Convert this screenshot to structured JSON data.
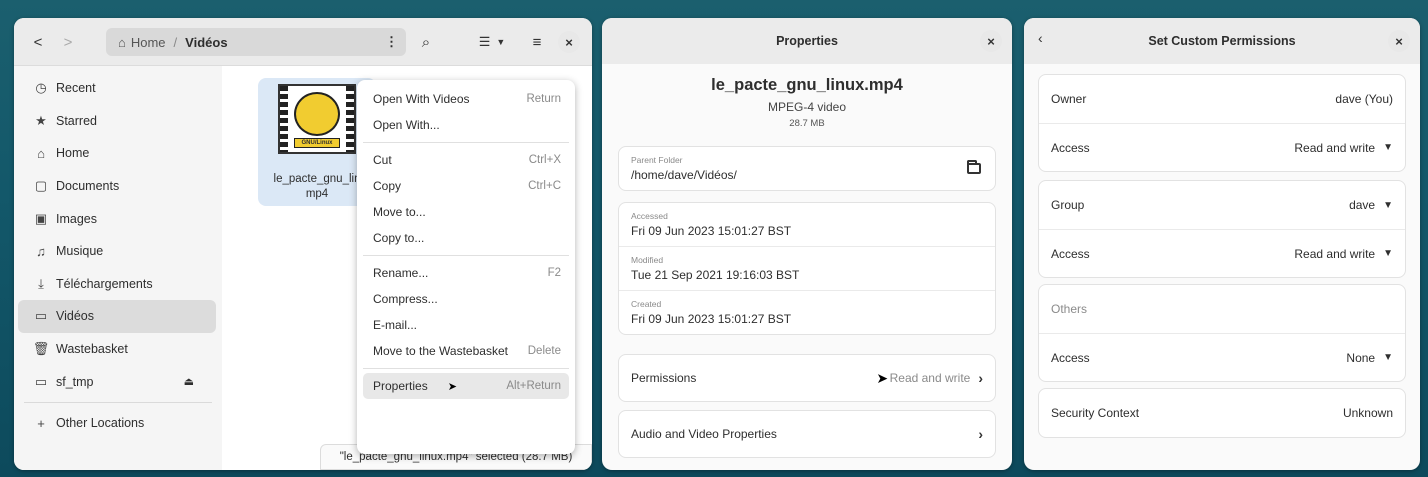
{
  "files": {
    "back_glyph": "<",
    "forward_glyph": ">",
    "path": {
      "home": "Home",
      "separator": "/",
      "current": "Vidéos"
    },
    "sidebar": [
      {
        "icon": "clock-icon",
        "glyph": "◷",
        "label": "Recent"
      },
      {
        "icon": "star-icon",
        "glyph": "★",
        "label": "Starred"
      },
      {
        "icon": "home-icon",
        "glyph": "⌂",
        "label": "Home"
      },
      {
        "icon": "document-icon",
        "glyph": "▢",
        "label": "Documents"
      },
      {
        "icon": "image-icon",
        "glyph": "▣",
        "label": "Images"
      },
      {
        "icon": "music-icon",
        "glyph": "♫",
        "label": "Musique"
      },
      {
        "icon": "download-icon",
        "glyph": "⤓",
        "label": "Téléchargements"
      },
      {
        "icon": "video-icon",
        "glyph": "▭",
        "label": "Vidéos"
      },
      {
        "icon": "trash-icon",
        "glyph": "🗑",
        "label": "Wastebasket"
      },
      {
        "icon": "drive-icon",
        "glyph": "▭",
        "label": "sf_tmp"
      }
    ],
    "other_locations": "Other Locations",
    "file": {
      "name_line1": "le_pacte_gnu_lin",
      "name_line2": "mp4",
      "thumb_label": "GNU/Linux"
    },
    "status": "\"le_pacte_gnu_linux.mp4\" selected  (28.7 MB)"
  },
  "context_menu": {
    "group1": [
      {
        "label": "Open With Videos",
        "accel": "Return"
      },
      {
        "label": "Open With...",
        "accel": ""
      }
    ],
    "group2": [
      {
        "label": "Cut",
        "accel": "Ctrl+X"
      },
      {
        "label": "Copy",
        "accel": "Ctrl+C"
      },
      {
        "label": "Move to...",
        "accel": ""
      },
      {
        "label": "Copy to...",
        "accel": ""
      }
    ],
    "group3": [
      {
        "label": "Rename...",
        "accel": "F2"
      },
      {
        "label": "Compress...",
        "accel": ""
      },
      {
        "label": "E-mail...",
        "accel": ""
      },
      {
        "label": "Move to the Wastebasket",
        "accel": "Delete"
      }
    ],
    "group4": [
      {
        "label": "Properties",
        "accel": "Alt+Return"
      }
    ]
  },
  "properties": {
    "title": "Properties",
    "file_name": "le_pacte_gnu_linux.mp4",
    "file_type": "MPEG-4 video",
    "file_size": "28.7 MB",
    "parent_folder_label": "Parent Folder",
    "parent_folder_value": "/home/dave/Vidéos/",
    "accessed_label": "Accessed",
    "accessed_value": "Fri 09 Jun 2023 15:01:27 BST",
    "modified_label": "Modified",
    "modified_value": "Tue 21 Sep 2021 19:16:03 BST",
    "created_label": "Created",
    "created_value": "Fri 09 Jun 2023 15:01:27 BST",
    "permissions_label": "Permissions",
    "permissions_value": "Read and write",
    "av_label": "Audio and Video Properties"
  },
  "permissions": {
    "title": "Set Custom Permissions",
    "owner_label": "Owner",
    "owner_value": "dave (You)",
    "owner_access_label": "Access",
    "owner_access_value": "Read and write",
    "group_label": "Group",
    "group_value": "dave",
    "group_access_label": "Access",
    "group_access_value": "Read and write",
    "others_label": "Others",
    "others_access_label": "Access",
    "others_access_value": "None",
    "security_label": "Security Context",
    "security_value": "Unknown"
  }
}
